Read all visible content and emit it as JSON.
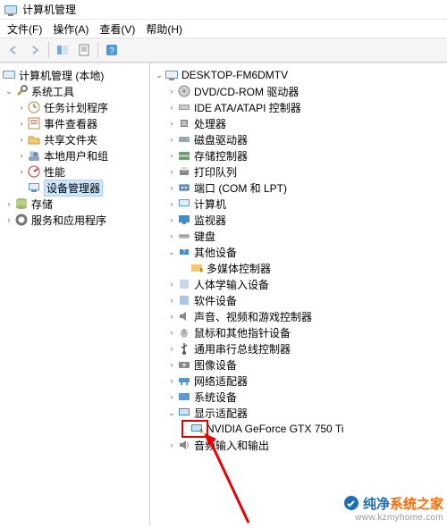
{
  "window": {
    "title": "计算机管理"
  },
  "menu": {
    "file": "文件(F)",
    "action": "操作(A)",
    "view": "查看(V)",
    "help": "帮助(H)"
  },
  "left_tree": {
    "root": "计算机管理 (本地)",
    "system_tools": "系统工具",
    "task_scheduler": "任务计划程序",
    "event_viewer": "事件查看器",
    "shared_folders": "共享文件夹",
    "local_users": "本地用户和组",
    "performance": "性能",
    "device_manager": "设备管理器",
    "storage": "存储",
    "services_apps": "服务和应用程序"
  },
  "right_tree": {
    "host": "DESKTOP-FM6DMTV",
    "dvd": "DVD/CD-ROM 驱动器",
    "ide": "IDE ATA/ATAPI 控制器",
    "cpu": "处理器",
    "disk": "磁盘驱动器",
    "storage_ctrl": "存储控制器",
    "print_queues": "打印队列",
    "ports": "端口 (COM 和 LPT)",
    "computer": "计算机",
    "monitors": "监视器",
    "keyboards": "键盘",
    "other_devices": "其他设备",
    "mm_controller": "多媒体控制器",
    "hid": "人体学输入设备",
    "software_devices": "软件设备",
    "sound": "声音、视频和游戏控制器",
    "mice": "鼠标和其他指针设备",
    "usb": "通用串行总线控制器",
    "imaging": "图像设备",
    "network": "网络适配器",
    "system_devices": "系统设备",
    "display_adapters": "显示适配器",
    "gpu": "NVIDIA GeForce GTX 750 Ti",
    "audio_io": "音频输入和输出"
  },
  "watermark": {
    "brand_prefix": "纯净",
    "brand_suffix": "系统之家",
    "url": "www.kzmyhome.com"
  }
}
